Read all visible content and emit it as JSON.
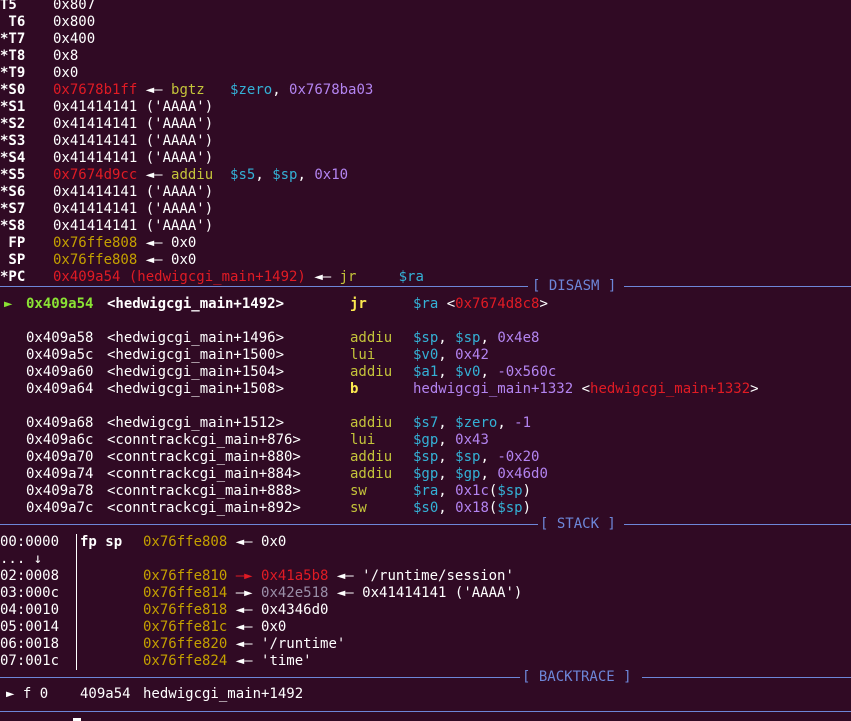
{
  "registers": [
    {
      "name": "T5",
      "value": "0x807",
      "cls": "c-white",
      "ann": []
    },
    {
      "name": " T6",
      "value": "0x800",
      "cls": "c-white",
      "ann": []
    },
    {
      "name": "*T7",
      "value": "0x400",
      "cls": "c-white",
      "ann": []
    },
    {
      "name": "*T8",
      "value": "0x8",
      "cls": "c-white",
      "ann": []
    },
    {
      "name": "*T9",
      "value": "0x0",
      "cls": "c-white",
      "ann": []
    },
    {
      "name": "*S0",
      "value": "0x7678b1ff",
      "cls": "c-red",
      "ann": [
        {
          "t": " ◄— ",
          "c": "c-white"
        },
        {
          "t": "bgtz   ",
          "c": "c-olive"
        },
        {
          "t": "$zero",
          "c": "c-cyan"
        },
        {
          "t": ", ",
          "c": "c-white"
        },
        {
          "t": "0x7678ba03",
          "c": "c-purple"
        }
      ]
    },
    {
      "name": "*S1",
      "value": "0x41414141 ('AAAA')",
      "cls": "c-white",
      "ann": []
    },
    {
      "name": "*S2",
      "value": "0x41414141 ('AAAA')",
      "cls": "c-white",
      "ann": []
    },
    {
      "name": "*S3",
      "value": "0x41414141 ('AAAA')",
      "cls": "c-white",
      "ann": []
    },
    {
      "name": "*S4",
      "value": "0x41414141 ('AAAA')",
      "cls": "c-white",
      "ann": []
    },
    {
      "name": "*S5",
      "value": "0x7674d9cc",
      "cls": "c-red",
      "ann": [
        {
          "t": " ◄— ",
          "c": "c-white"
        },
        {
          "t": "addiu  ",
          "c": "c-olive"
        },
        {
          "t": "$s5",
          "c": "c-cyan"
        },
        {
          "t": ", ",
          "c": "c-white"
        },
        {
          "t": "$sp",
          "c": "c-cyan"
        },
        {
          "t": ", ",
          "c": "c-white"
        },
        {
          "t": "0x10",
          "c": "c-purple"
        }
      ]
    },
    {
      "name": "*S6",
      "value": "0x41414141 ('AAAA')",
      "cls": "c-white",
      "ann": []
    },
    {
      "name": "*S7",
      "value": "0x41414141 ('AAAA')",
      "cls": "c-white",
      "ann": []
    },
    {
      "name": "*S8",
      "value": "0x41414141 ('AAAA')",
      "cls": "c-white",
      "ann": []
    },
    {
      "name": " FP",
      "value": "0x76ffe808",
      "cls": "c-yellow",
      "ann": [
        {
          "t": " ◄— 0x0",
          "c": "c-white"
        }
      ]
    },
    {
      "name": " SP",
      "value": "0x76ffe808",
      "cls": "c-yellow",
      "ann": [
        {
          "t": " ◄— 0x0",
          "c": "c-white"
        }
      ]
    },
    {
      "name": "*PC",
      "value": "0x409a54 (hedwigcgi_main+1492)",
      "cls": "c-red",
      "ann": [
        {
          "t": " ◄— ",
          "c": "c-white"
        },
        {
          "t": "jr     ",
          "c": "c-olive"
        },
        {
          "t": "$ra",
          "c": "c-cyan"
        }
      ]
    }
  ],
  "sections": {
    "disasm": "[ DISASM ]",
    "stack": "[ STACK ]",
    "backtrace": "[ BACKTRACE ]"
  },
  "disasm": [
    {
      "current": true,
      "marker": "► ",
      "addr": "0x409a54",
      "sym": "<hedwigcgi_main+1492>",
      "mn": "jr",
      "ops": [
        {
          "t": "$ra",
          "c": "c-cyan"
        },
        {
          "t": " <",
          "c": "c-white"
        },
        {
          "t": "0x7674d8c8",
          "c": "c-red"
        },
        {
          "t": ">",
          "c": "c-white"
        }
      ]
    },
    {
      "blank": true
    },
    {
      "addr": "0x409a58",
      "sym": "<hedwigcgi_main+1496>",
      "mn": "addiu",
      "ops": [
        {
          "t": "$sp",
          "c": "c-cyan"
        },
        {
          "t": ", ",
          "c": "c-white"
        },
        {
          "t": "$sp",
          "c": "c-cyan"
        },
        {
          "t": ", ",
          "c": "c-white"
        },
        {
          "t": "0x4e8",
          "c": "c-purple"
        }
      ]
    },
    {
      "addr": "0x409a5c",
      "sym": "<hedwigcgi_main+1500>",
      "mn": "lui",
      "ops": [
        {
          "t": "$v0",
          "c": "c-cyan"
        },
        {
          "t": ", ",
          "c": "c-white"
        },
        {
          "t": "0x42",
          "c": "c-purple"
        }
      ]
    },
    {
      "addr": "0x409a60",
      "sym": "<hedwigcgi_main+1504>",
      "mn": "addiu",
      "ops": [
        {
          "t": "$a1",
          "c": "c-cyan"
        },
        {
          "t": ", ",
          "c": "c-white"
        },
        {
          "t": "$v0",
          "c": "c-cyan"
        },
        {
          "t": ", ",
          "c": "c-white"
        },
        {
          "t": "-0x560c",
          "c": "c-purple"
        }
      ]
    },
    {
      "addr": "0x409a64",
      "sym": "<hedwigcgi_main+1508>",
      "mn": "b",
      "mnbold": true,
      "ops": [
        {
          "t": "hedwigcgi_main+1332",
          "c": "c-purple"
        },
        {
          "t": " <",
          "c": "c-white"
        },
        {
          "t": "hedwigcgi_main+1332",
          "c": "c-red"
        },
        {
          "t": ">",
          "c": "c-white"
        }
      ]
    },
    {
      "blank": true
    },
    {
      "addr": "0x409a68",
      "sym": "<hedwigcgi_main+1512>",
      "mn": "addiu",
      "ops": [
        {
          "t": "$s7",
          "c": "c-cyan"
        },
        {
          "t": ", ",
          "c": "c-white"
        },
        {
          "t": "$zero",
          "c": "c-cyan"
        },
        {
          "t": ", ",
          "c": "c-white"
        },
        {
          "t": "-1",
          "c": "c-purple"
        }
      ]
    },
    {
      "addr": "0x409a6c",
      "sym": "<conntrackcgi_main+876>",
      "mn": "lui",
      "ops": [
        {
          "t": "$gp",
          "c": "c-cyan"
        },
        {
          "t": ", ",
          "c": "c-white"
        },
        {
          "t": "0x43",
          "c": "c-purple"
        }
      ]
    },
    {
      "addr": "0x409a70",
      "sym": "<conntrackcgi_main+880>",
      "mn": "addiu",
      "ops": [
        {
          "t": "$sp",
          "c": "c-cyan"
        },
        {
          "t": ", ",
          "c": "c-white"
        },
        {
          "t": "$sp",
          "c": "c-cyan"
        },
        {
          "t": ", ",
          "c": "c-white"
        },
        {
          "t": "-0x20",
          "c": "c-purple"
        }
      ]
    },
    {
      "addr": "0x409a74",
      "sym": "<conntrackcgi_main+884>",
      "mn": "addiu",
      "ops": [
        {
          "t": "$gp",
          "c": "c-cyan"
        },
        {
          "t": ", ",
          "c": "c-white"
        },
        {
          "t": "$gp",
          "c": "c-cyan"
        },
        {
          "t": ", ",
          "c": "c-white"
        },
        {
          "t": "0x46d0",
          "c": "c-purple"
        }
      ]
    },
    {
      "addr": "0x409a78",
      "sym": "<conntrackcgi_main+888>",
      "mn": "sw",
      "ops": [
        {
          "t": "$ra",
          "c": "c-cyan"
        },
        {
          "t": ", ",
          "c": "c-white"
        },
        {
          "t": "0x1c",
          "c": "c-purple"
        },
        {
          "t": "(",
          "c": "c-white"
        },
        {
          "t": "$sp",
          "c": "c-cyan"
        },
        {
          "t": ")",
          "c": "c-white"
        }
      ]
    },
    {
      "addr": "0x409a7c",
      "sym": "<conntrackcgi_main+892>",
      "mn": "sw",
      "ops": [
        {
          "t": "$s0",
          "c": "c-cyan"
        },
        {
          "t": ", ",
          "c": "c-white"
        },
        {
          "t": "0x18",
          "c": "c-purple"
        },
        {
          "t": "(",
          "c": "c-white"
        },
        {
          "t": "$sp",
          "c": "c-cyan"
        },
        {
          "t": ")",
          "c": "c-white"
        }
      ]
    }
  ],
  "stack": [
    {
      "idx": "00:0000",
      "regs": "fp sp",
      "addr": "0x76ffe808",
      "rest": [
        {
          "t": " ◄— 0x0",
          "c": "c-white"
        }
      ]
    },
    {
      "idx": "... ↓",
      "regs": "",
      "addr": "",
      "rest": []
    },
    {
      "idx": "02:0008",
      "regs": "",
      "addr": "0x76ffe810",
      "rest": [
        {
          "t": " —► ",
          "c": "c-red"
        },
        {
          "t": "0x41a5b8",
          "c": "c-red"
        },
        {
          "t": " ◄— '/runtime/session'",
          "c": "c-white"
        }
      ]
    },
    {
      "idx": "03:000c",
      "regs": "",
      "addr": "0x76ffe814",
      "rest": [
        {
          "t": " —► ",
          "c": "c-white"
        },
        {
          "t": "0x42e518",
          "c": "c-grey"
        },
        {
          "t": " ◄— 0x41414141 ('AAAA')",
          "c": "c-white"
        }
      ]
    },
    {
      "idx": "04:0010",
      "regs": "",
      "addr": "0x76ffe818",
      "rest": [
        {
          "t": " ◄— 0x4346d0",
          "c": "c-white"
        }
      ]
    },
    {
      "idx": "05:0014",
      "regs": "",
      "addr": "0x76ffe81c",
      "rest": [
        {
          "t": " ◄— 0x0",
          "c": "c-white"
        }
      ]
    },
    {
      "idx": "06:0018",
      "regs": "",
      "addr": "0x76ffe820",
      "rest": [
        {
          "t": " ◄— '/runtime'",
          "c": "c-white"
        }
      ]
    },
    {
      "idx": "07:001c",
      "regs": "",
      "addr": "0x76ffe824",
      "rest": [
        {
          "t": " ◄— 'time'",
          "c": "c-white"
        }
      ]
    }
  ],
  "backtrace": [
    {
      "marker": "► f 0",
      "addr": "409a54",
      "sym": "hedwigcgi_main+1492"
    }
  ]
}
